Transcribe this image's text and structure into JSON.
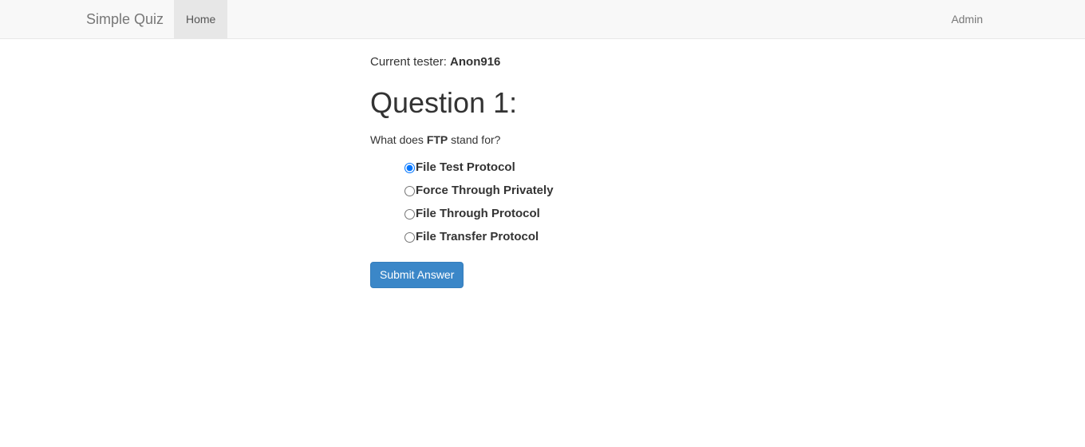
{
  "navbar": {
    "brand": "Simple Quiz",
    "items": [
      {
        "label": "Home",
        "active": true
      },
      {
        "label": "Admin",
        "active": false
      }
    ],
    "background": "#f8f8f8",
    "active_background": "#e7e7e7"
  },
  "main": {
    "tester_prefix": "Current tester:",
    "tester_name": "Anon916",
    "question_heading": "Question 1:",
    "question_prefix": "What does ",
    "question_keyword": "FTP",
    "question_suffix": " stand for?",
    "options": [
      {
        "label": "File Test Protocol",
        "selected": true
      },
      {
        "label": "Force Through Privately",
        "selected": false
      },
      {
        "label": "File Through Protocol",
        "selected": false
      },
      {
        "label": "File Transfer Protocol",
        "selected": false
      }
    ],
    "submit_label": "Submit Answer",
    "submit_color": "#3b87c8"
  }
}
